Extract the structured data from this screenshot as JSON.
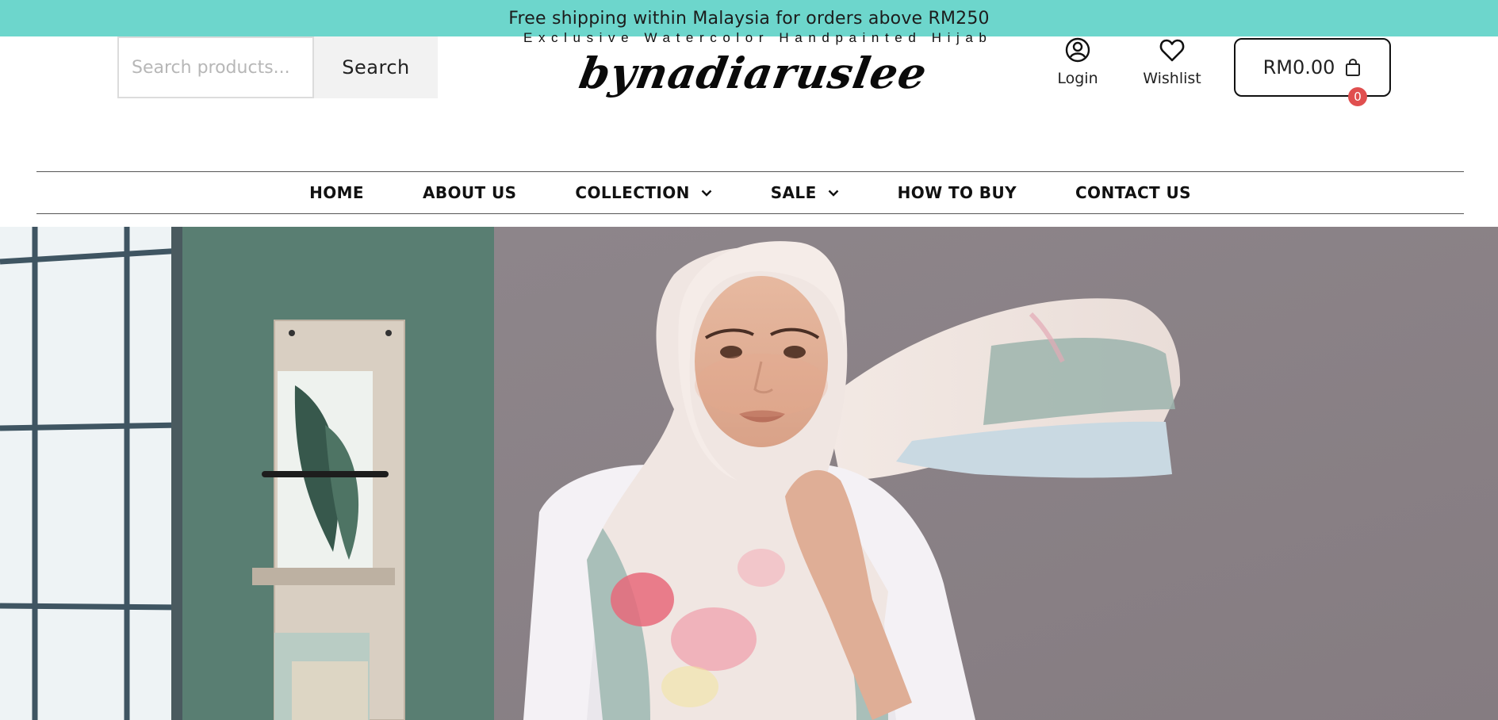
{
  "announcement": {
    "text": "Free shipping within Malaysia for orders above RM250"
  },
  "search": {
    "placeholder": "Search products...",
    "button_label": "Search"
  },
  "logo": {
    "tagline": "Exclusive Watercolor Handpainted Hijab",
    "name": "bynadiaruslee"
  },
  "account": {
    "login_label": "Login",
    "wishlist_label": "Wishlist"
  },
  "cart": {
    "total": "RM0.00",
    "count": "0"
  },
  "nav": {
    "items": [
      {
        "label": "HOME",
        "has_dropdown": false
      },
      {
        "label": "ABOUT US",
        "has_dropdown": false
      },
      {
        "label": "COLLECTION",
        "has_dropdown": true
      },
      {
        "label": "SALE",
        "has_dropdown": true
      },
      {
        "label": "HOW TO BUY",
        "has_dropdown": false
      },
      {
        "label": "CONTACT US",
        "has_dropdown": false
      }
    ]
  },
  "colors": {
    "announcement_bg": "#6dd6cc",
    "cart_badge": "#e04f4f",
    "hero_backdrop": "#8d8489",
    "wall_teal": "#5e8479"
  },
  "icons": {
    "login": "user-circle-icon",
    "wishlist": "heart-icon",
    "cart": "shopping-bag-icon",
    "dropdown": "chevron-down-icon"
  }
}
